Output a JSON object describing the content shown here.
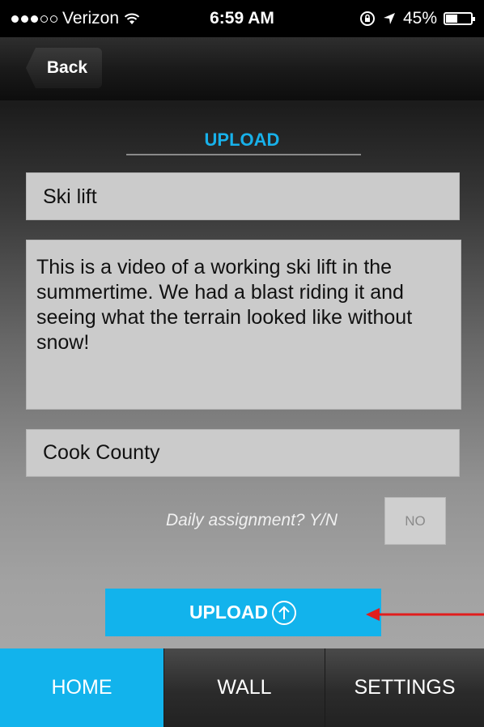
{
  "status_bar": {
    "carrier": "Verizon",
    "time": "6:59 AM",
    "battery": "45%",
    "battery_level": 0.45,
    "signal_bars": 3,
    "icons": [
      "wifi-icon",
      "rotation-lock-icon",
      "location-arrow-icon",
      "battery-icon"
    ]
  },
  "nav": {
    "back_label": "Back"
  },
  "form": {
    "heading": "UPLOAD",
    "title_value": "Ski lift",
    "description_value": "This is a video of a working ski lift in the summertime. We had a blast riding it and seeing what the terrain looked like without snow!",
    "location_value": "Cook County",
    "daily_label": "Daily assignment? Y/N",
    "daily_toggle": "NO",
    "upload_label": "UPLOAD",
    "upload_icon": "upload-arrow-circle-icon"
  },
  "tabs": [
    {
      "label": "HOME",
      "active": true
    },
    {
      "label": "WALL",
      "active": false
    },
    {
      "label": "SETTINGS",
      "active": false
    }
  ],
  "colors": {
    "accent": "#12b3ec",
    "annotation_arrow": "#e11d1d"
  }
}
